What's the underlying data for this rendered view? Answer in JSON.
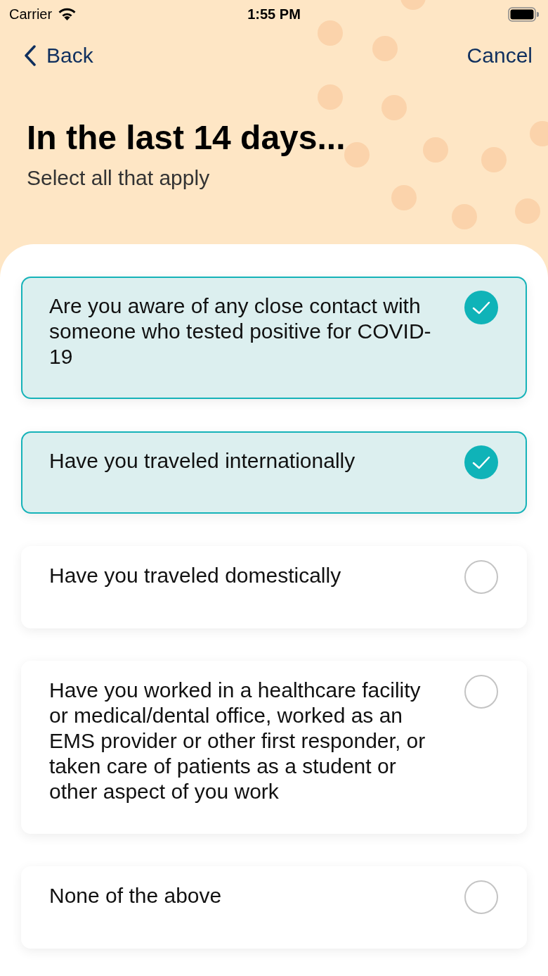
{
  "status_bar": {
    "carrier": "Carrier",
    "time": "1:55 PM"
  },
  "nav": {
    "back": "Back",
    "cancel": "Cancel"
  },
  "header": {
    "title": "In the last 14 days...",
    "subtitle": "Select all that apply"
  },
  "options": [
    {
      "label": "Are you aware of any close contact with someone who tested positive for COVID-19",
      "checked": true
    },
    {
      "label": "Have you traveled internationally",
      "checked": true
    },
    {
      "label": "Have you traveled domestically",
      "checked": false
    },
    {
      "label": "Have you worked in a healthcare facility or medical/dental office, worked as an EMS provider or other first responder, or taken care of patients as a student or other aspect of you work",
      "checked": false
    },
    {
      "label": "None of the above",
      "checked": false
    }
  ]
}
